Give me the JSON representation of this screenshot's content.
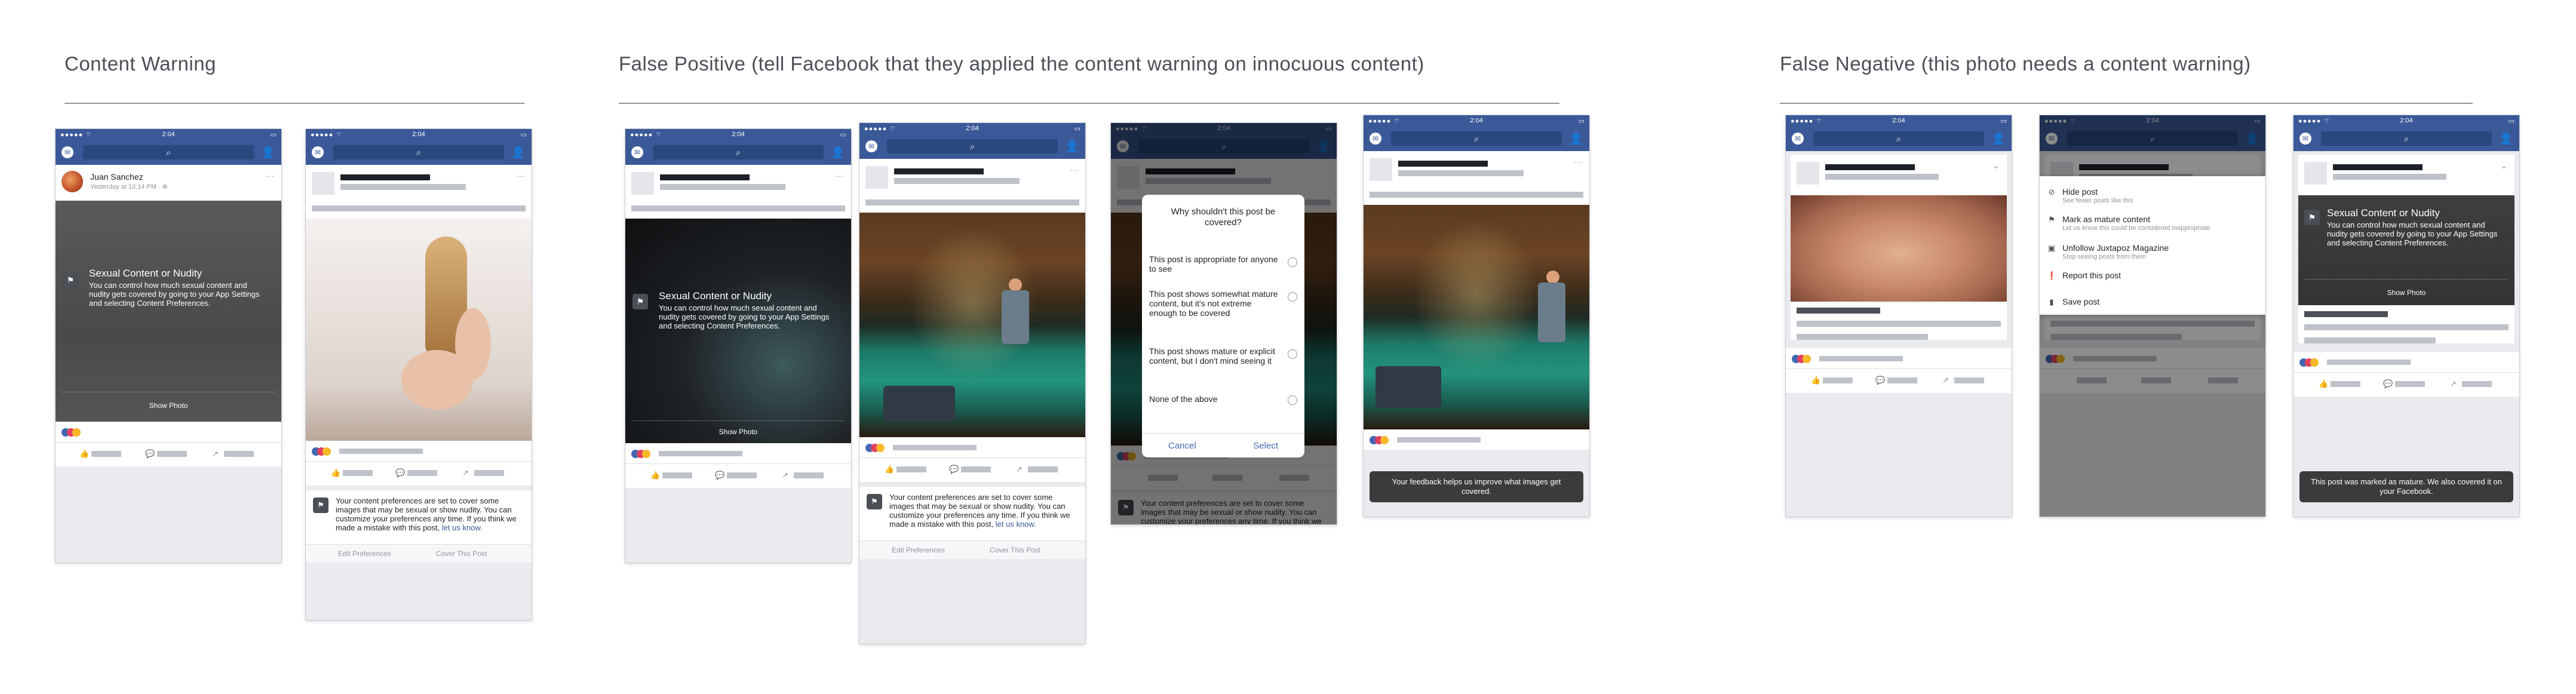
{
  "sections": {
    "content_warning": "Content Warning",
    "false_positive": "False Positive (tell Facebook that they applied the content warning on innocuous content)",
    "false_negative": "False Negative (this photo needs a content warning)"
  },
  "status_bar": {
    "signal": "●●●●● ⌔",
    "time": "2:04",
    "battery": "▭"
  },
  "icons": {
    "messenger": "messenger-icon",
    "search": "search-icon",
    "friends": "friend-requests-icon",
    "shield": "content-warning-icon"
  },
  "post1": {
    "author": "Juan Sanchez",
    "meta": "Yesterday at 10:14 PM · ⊕",
    "more": "···"
  },
  "cover": {
    "title": "Sexual Content or Nudity",
    "body": "You can control how much sexual content and nudity gets covered by going to your App Settings and selecting Content Preferences.",
    "show_photo": "Show Photo"
  },
  "preferences_notice": {
    "text": "Your content preferences are set to cover some images that may be sexual or show nudity. You can customize your preferences any time. If you think we made a mistake with this post,",
    "link": "let us know.",
    "edit": "Edit Preferences",
    "cover": "Cover This Post"
  },
  "dialog": {
    "title": "Why shouldn't this post be covered?",
    "options": [
      "This post is appropriate for anyone to see",
      "This post shows somewhat mature content, but it's not extreme enough to be covered",
      "This post shows mature or explicit content, but I don't mind seeing it",
      "None of the above"
    ],
    "cancel": "Cancel",
    "select": "Select"
  },
  "toast_feedback": "Your feedback helps us improve what images get covered.",
  "toast_marked": "This post was marked as mature. We also covered it on your Facebook.",
  "menu": [
    {
      "title": "Hide post",
      "sub": "See fewer posts like this",
      "icon": "hide-icon"
    },
    {
      "title": "Mark as mature content",
      "sub": "Let us know this could be considered inappropriate",
      "icon": "mature-icon"
    },
    {
      "title": "Unfollow Juxtapoz Magazine",
      "sub": "Stop seeing posts from them",
      "icon": "unfollow-icon"
    },
    {
      "title": "Report this post",
      "sub": "",
      "icon": "report-icon"
    },
    {
      "title": "Save post",
      "sub": "",
      "icon": "save-icon"
    }
  ]
}
